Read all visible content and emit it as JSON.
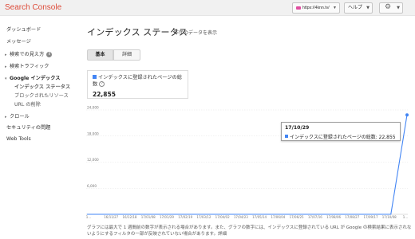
{
  "app": {
    "brand": "Search Console"
  },
  "header": {
    "site_selector": "https://4knn.tv/",
    "help_label": "ヘルプ",
    "gear_icon": "gear-icon"
  },
  "sidebar": {
    "items": [
      {
        "label": "ダッシュボード"
      },
      {
        "label": "メッセージ"
      },
      {
        "label": "検索での見え方",
        "info": "i"
      },
      {
        "label": "検索トラフィック"
      },
      {
        "label": "Google インデックス"
      },
      {
        "label": "インデックス ステータス"
      },
      {
        "label": "ブロックされたリソース"
      },
      {
        "label": "URL の削除"
      },
      {
        "label": "クロール"
      },
      {
        "label": "セキュリティの問題"
      },
      {
        "label": "Web Tools"
      }
    ],
    "arrow_collapsed": "▸",
    "arrow_expanded": "▾"
  },
  "main": {
    "title": "インデックス ステータス",
    "subtitle": "昨年のデータを表示",
    "tabs": [
      {
        "label": "基本"
      },
      {
        "label": "詳細"
      }
    ],
    "metric": {
      "label": "インデックスに登録されたページの総数",
      "help": "?",
      "value": "22,855"
    },
    "tooltip": {
      "date": "17/10/29",
      "text": "インデックスに登録されたページの総数: 22,855"
    },
    "footnote": "グラフには最大で 1 週間前の数字が表示される場合があります。また、グラフの数字には、インデックスに登録されている URL が Google の検索結果に表示されないようにするフィルタの一部が反映されていない場合があります。詳細"
  },
  "chart_data": {
    "type": "line",
    "y_ticks": [
      "24,000",
      "18,000",
      "12,000",
      "6,000"
    ],
    "y_tick_values": [
      24000,
      18000,
      12000,
      6000
    ],
    "ylim": [
      0,
      24000
    ],
    "x_labels": [
      "1…",
      "16/11/27",
      "16/12/18",
      "17/01/08",
      "17/01/29",
      "17/02/19",
      "17/03/12",
      "17/04/02",
      "17/04/23",
      "17/05/14",
      "17/06/04",
      "17/06/25",
      "17/07/16",
      "17/08/06",
      "17/08/27",
      "17/09/17",
      "17/10/08",
      "1…"
    ],
    "series": [
      {
        "name": "インデックスに登録されたページの総数",
        "color": "#4285f4",
        "points": [
          {
            "x": "1…",
            "y": 0
          },
          {
            "x": "17/10/08",
            "y": 0
          },
          {
            "x": "17/10/29",
            "y": 22855
          }
        ]
      }
    ],
    "grid": true,
    "accent_color": "#4285f4"
  }
}
